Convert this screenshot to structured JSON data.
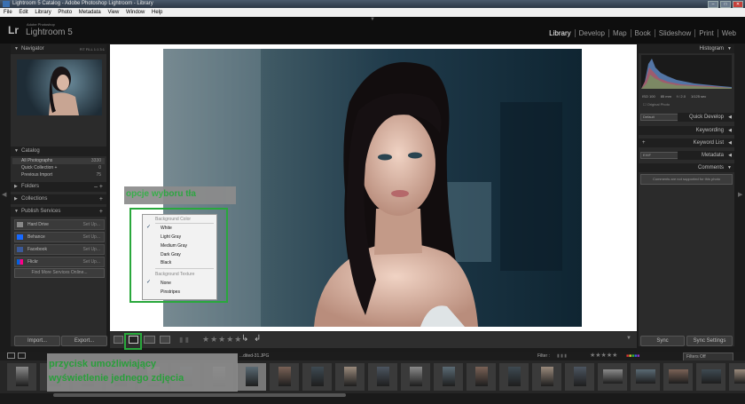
{
  "window": {
    "title": "Lightroom 5 Catalog - Adobe Photoshop Lightroom - Library"
  },
  "menu": [
    "File",
    "Edit",
    "Library",
    "Photo",
    "Metadata",
    "View",
    "Window",
    "Help"
  ],
  "identity": {
    "logo": "Lr",
    "adobe": "Adobe Photoshop",
    "product": "Lightroom 5"
  },
  "modules": [
    "Library",
    "Develop",
    "Map",
    "Book",
    "Slideshow",
    "Print",
    "Web"
  ],
  "active_module": "Library",
  "left_panel": {
    "navigator": {
      "title": "Navigator",
      "options": "FIT  FILL  1:1  3:1"
    },
    "catalog": {
      "title": "Catalog",
      "items": [
        {
          "label": "All Photographs",
          "count": "3330"
        },
        {
          "label": "Quick Collection +",
          "count": "0"
        },
        {
          "label": "Previous Import",
          "count": "75"
        }
      ]
    },
    "folders": "Folders",
    "collections": "Collections",
    "publish": {
      "title": "Publish Services",
      "services": [
        {
          "label": "Hard Drive",
          "action": "Set Up..."
        },
        {
          "label": "Behance",
          "action": "Set Up..."
        },
        {
          "label": "Facebook",
          "action": "Set Up..."
        },
        {
          "label": "Flickr",
          "action": "Set Up..."
        }
      ],
      "find_more": "Find More Services Online..."
    },
    "import": "Import...",
    "export": "Export..."
  },
  "right_panel": {
    "histogram": {
      "title": "Histogram",
      "iso": "ISO 100",
      "focal": "85 mm",
      "aperture": "f / 2.0",
      "shutter": "1/125 sec",
      "original": "Original Photo"
    },
    "quick_develop": {
      "title": "Quick Develop",
      "preset": "Default"
    },
    "keywording": "Keywording",
    "keyword_list": "Keyword List",
    "metadata": {
      "title": "Metadata",
      "preset": "EXIF"
    },
    "comments": {
      "title": "Comments",
      "note": "Comments are not supported for this photo"
    },
    "sync": "Sync",
    "sync_settings": "Sync Settings"
  },
  "context_menu": {
    "background_color_header": "Background Color",
    "colors": [
      "White",
      "Light Gray",
      "Medium Gray",
      "Dark Gray",
      "Black"
    ],
    "checked_color": "White",
    "texture_header": "Background Texture",
    "textures": [
      "None",
      "Pinstripes"
    ],
    "checked_texture": "None"
  },
  "annotations": {
    "top": "opcje wyboru tła",
    "bottom_line1": "przycisk umożliwiający",
    "bottom_line2": "wyświetlenie jednego zdjęcia"
  },
  "filmstrip": {
    "filename": "...dited-31.JPG",
    "filter_label": "Filter :",
    "filters_off": "Filters Off",
    "thumb_count": 23,
    "selected_index": 7
  },
  "toolbar": {
    "stars": "★★★★★"
  },
  "colors": {
    "annotation_green": "#29a83c",
    "panel_bg": "#2b2b2b",
    "canvas_bg": "#ffffff"
  }
}
